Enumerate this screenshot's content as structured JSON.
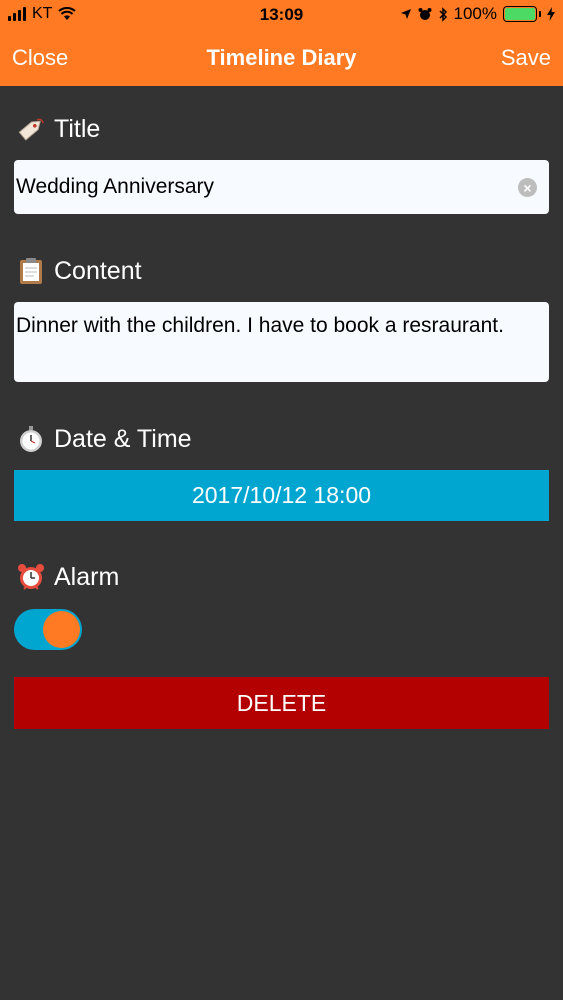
{
  "status_bar": {
    "carrier": "KT",
    "time": "13:09",
    "battery": "100%"
  },
  "nav": {
    "close_label": "Close",
    "title": "Timeline Diary",
    "save_label": "Save"
  },
  "form": {
    "title": {
      "label": "Title",
      "value": "Wedding Anniversary",
      "icon": "label-tag-icon"
    },
    "content": {
      "label": "Content",
      "value": "Dinner with the children. I have to book a resraurant.",
      "icon": "clipboard-icon"
    },
    "datetime": {
      "label": "Date & Time",
      "value": "2017/10/12 18:00",
      "icon": "stopwatch-icon"
    },
    "alarm": {
      "label": "Alarm",
      "enabled": true,
      "icon": "alarm-clock-icon"
    },
    "delete_label": "DELETE"
  },
  "colors": {
    "accent": "#FF7A22",
    "background": "#333333",
    "date_button": "#00A6CF",
    "delete_button": "#B30000"
  }
}
